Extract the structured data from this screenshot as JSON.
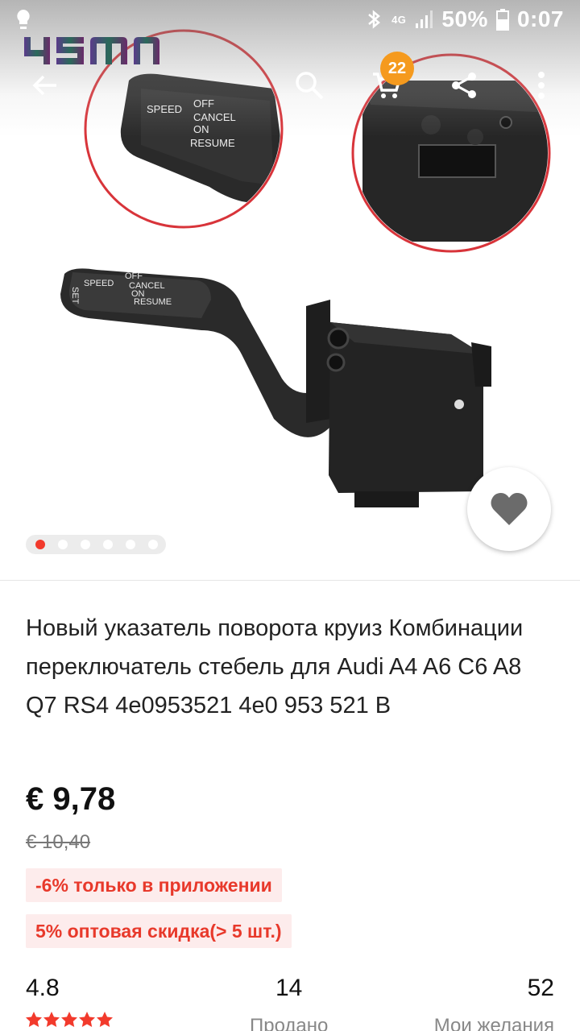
{
  "status": {
    "network": "4G",
    "battery": "50%",
    "time": "0:07"
  },
  "app": {
    "logo_text": "чsm",
    "cart_count": "22"
  },
  "gallery": {
    "dots": 6,
    "active_dot": 0
  },
  "product": {
    "title": "Новый указатель поворота круиз Комбинации переключатель стебель для Audi A4 A6 C6 A8 Q7 RS4 4e0953521 4e0 953 521 B",
    "price": "€ 9,78",
    "old_price": "€ 10,40",
    "promos": [
      "-6% только в приложении",
      "5% оптовая скидка(> 5 шт.)"
    ]
  },
  "lever_labels": {
    "set": "SET",
    "speed": "SPEED",
    "off": "OFF",
    "cancel": "CANCEL",
    "on": "ON",
    "resume": "RESUME"
  },
  "stats": {
    "rating": "4.8",
    "rating_stars": 5,
    "sold_value": "14",
    "sold_label": "Продано",
    "wishlist_value": "52",
    "wishlist_label": "Мои желания"
  },
  "colors": {
    "accent": "#f23a2c",
    "badge": "#f59a1e",
    "promo_bg": "#fdecec"
  }
}
